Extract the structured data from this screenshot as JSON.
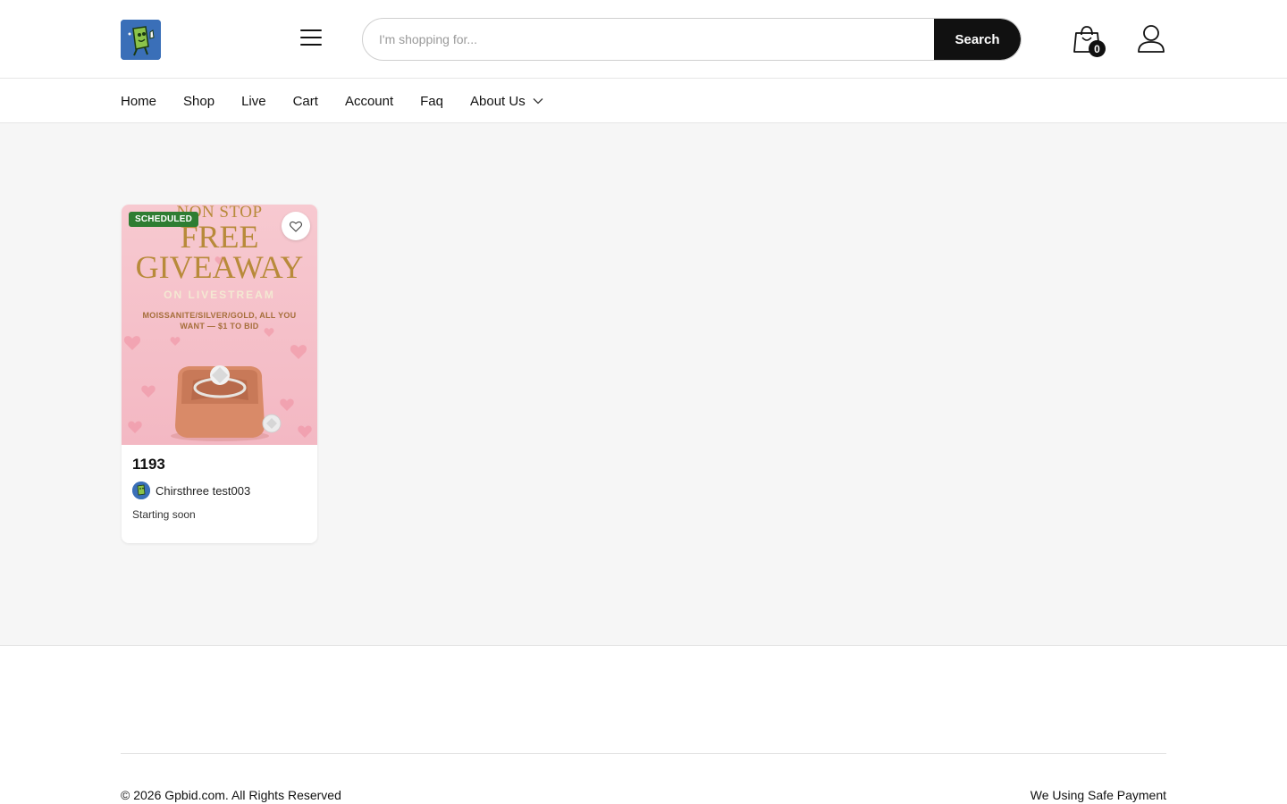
{
  "header": {
    "search": {
      "placeholder": "I'm shopping for...",
      "button_label": "Search"
    },
    "cart_count": "0"
  },
  "nav": {
    "items": [
      {
        "label": "Home"
      },
      {
        "label": "Shop"
      },
      {
        "label": "Live"
      },
      {
        "label": "Cart"
      },
      {
        "label": "Account"
      },
      {
        "label": "Faq"
      },
      {
        "label": "About Us"
      }
    ]
  },
  "listing": {
    "badge": "SCHEDULED",
    "promo": {
      "line1": "NON STOP",
      "line2": "FREE",
      "line3": "GIVEAWAY",
      "line4": "ON LIVESTREAM",
      "line5": "MOISSANITE/SILVER/GOLD, ALL YOU WANT — $1 TO BID"
    },
    "title": "1193",
    "seller": "Chirsthree test003",
    "status": "Starting soon"
  },
  "footer": {
    "copyright": "© 2026 Gpbid.com. All Rights Reserved",
    "safe_payment": "We Using Safe Payment"
  },
  "colors": {
    "brand_dark": "#111111",
    "badge_green": "#2e7d32",
    "logo_blue": "#3a6fb8",
    "page_bg": "#f6f6f6"
  }
}
